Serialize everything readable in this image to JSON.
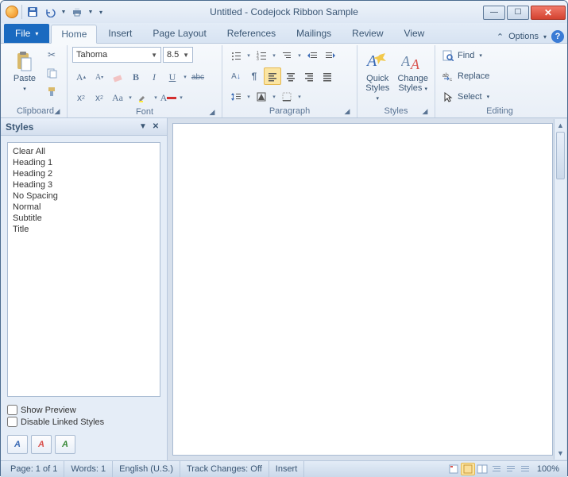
{
  "window": {
    "title": "Untitled - Codejock Ribbon Sample"
  },
  "tabs": {
    "file": "File",
    "items": [
      "Home",
      "Insert",
      "Page Layout",
      "References",
      "Mailings",
      "Review",
      "View"
    ],
    "options": "Options"
  },
  "ribbon": {
    "clipboard": {
      "paste": "Paste",
      "label": "Clipboard"
    },
    "font": {
      "name": "Tahoma",
      "size": "8.5",
      "label": "Font"
    },
    "paragraph": {
      "label": "Paragraph"
    },
    "styles": {
      "quick": "Quick Styles",
      "change": "Change Styles",
      "label": "Styles"
    },
    "editing": {
      "find": "Find",
      "replace": "Replace",
      "select": "Select",
      "label": "Editing"
    }
  },
  "pane": {
    "title": "Styles",
    "items": [
      "Clear All",
      "Heading 1",
      "Heading 2",
      "Heading 3",
      "No Spacing",
      "Normal",
      "Subtitle",
      "Title"
    ],
    "show_preview": "Show Preview",
    "disable_linked": "Disable Linked Styles"
  },
  "status": {
    "page": "Page: 1 of 1",
    "words": "Words: 1",
    "lang": "English (U.S.)",
    "track": "Track Changes: Off",
    "insert": "Insert",
    "zoom": "100%"
  }
}
